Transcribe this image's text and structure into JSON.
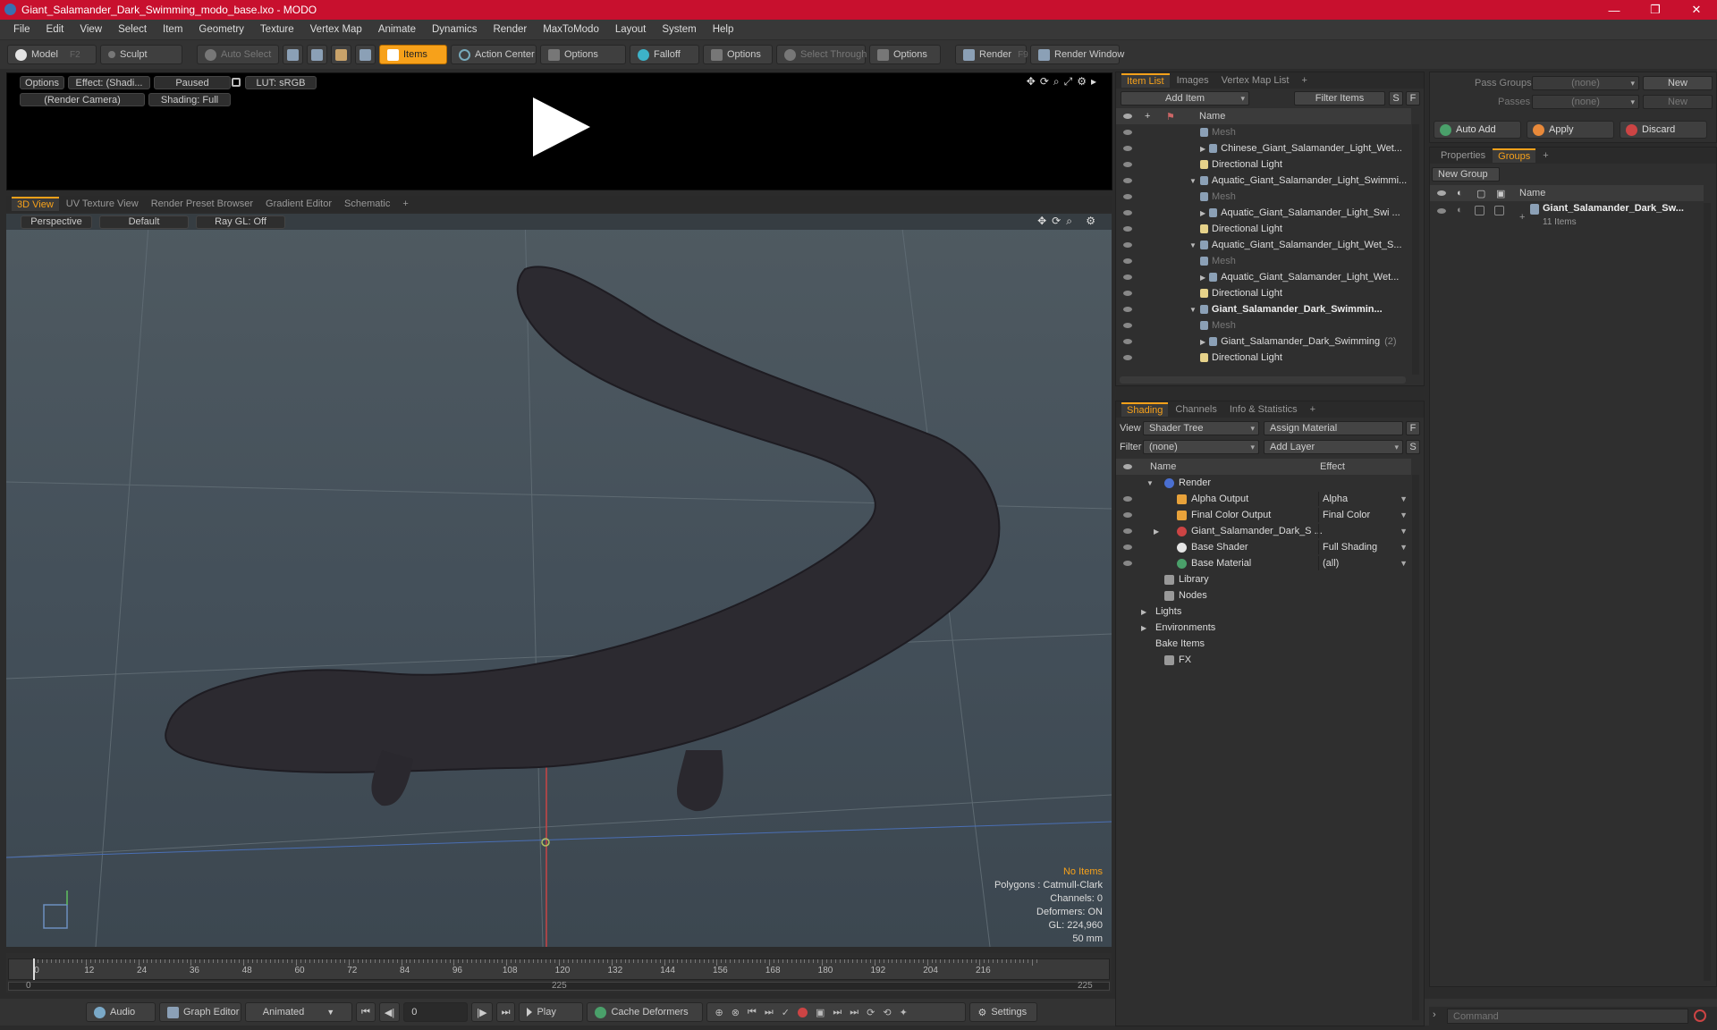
{
  "window": {
    "title": "Giant_Salamander_Dark_Swimming_modo_base.lxo - MODO",
    "controls": [
      "—",
      "❐",
      "✕"
    ]
  },
  "menu": [
    "File",
    "Edit",
    "View",
    "Select",
    "Item",
    "Geometry",
    "Texture",
    "Vertex Map",
    "Animate",
    "Dynamics",
    "Render",
    "MaxToModo",
    "Layout",
    "System",
    "Help"
  ],
  "toolbar": {
    "model": "Model",
    "model_key": "F2",
    "sculpt": "Sculpt",
    "auto_select": "Auto Select",
    "items": "Items",
    "action_center": "Action Center",
    "options1": "Options",
    "falloff": "Falloff",
    "options2": "Options",
    "select_through": "Select Through",
    "options3": "Options",
    "render": "Render",
    "render_key": "F9",
    "render_window": "Render Window"
  },
  "preview": {
    "options": "Options",
    "effect": "Effect: (Shadi...",
    "paused": "Paused",
    "lut": "LUT: sRGB",
    "camera": "(Render Camera)",
    "shading": "Shading: Full"
  },
  "view_tabs": [
    "3D View",
    "UV Texture View",
    "Render Preset Browser",
    "Gradient Editor",
    "Schematic",
    "+"
  ],
  "viewport": {
    "perspective": "Perspective",
    "default": "Default",
    "raygl": "Ray GL: Off",
    "stats": {
      "no_items": "No Items",
      "polygons": "Polygons : Catmull-Clark",
      "channels": "Channels: 0",
      "deformers": "Deformers: ON",
      "gl": "GL: 224,960",
      "mm": "50 mm"
    }
  },
  "timeline": {
    "ticks": [
      "0",
      "12",
      "24",
      "36",
      "48",
      "60",
      "72",
      "84",
      "96",
      "108",
      "120",
      "132",
      "144",
      "156",
      "168",
      "180",
      "192",
      "204",
      "216"
    ],
    "range_start": "0",
    "range_mid": "225",
    "range_end": "225"
  },
  "bottombar": {
    "audio": "Audio",
    "graph_editor": "Graph Editor",
    "animated": "Animated",
    "frame": "0",
    "play": "Play",
    "cache": "Cache Deformers",
    "settings": "Settings"
  },
  "itemlist": {
    "tabs": [
      "Item List",
      "Images",
      "Vertex Map List",
      "+"
    ],
    "add_item": "Add Item",
    "filter": "Filter Items",
    "s": "S",
    "f": "F",
    "name_header": "Name",
    "rows": [
      {
        "text": "Mesh",
        "indent": 2,
        "dim": true,
        "arrow": ""
      },
      {
        "text": "Chinese_Giant_Salamander_Light_Wet...",
        "indent": 2,
        "dim": false,
        "arrow": "▶"
      },
      {
        "text": "Directional Light",
        "indent": 2,
        "dim": false,
        "arrow": ""
      },
      {
        "text": "Aquatic_Giant_Salamander_Light_Swimmi...",
        "indent": 1,
        "dim": false,
        "arrow": "▼"
      },
      {
        "text": "Mesh",
        "indent": 2,
        "dim": true,
        "arrow": ""
      },
      {
        "text": "Aquatic_Giant_Salamander_Light_Swi ...",
        "indent": 2,
        "dim": false,
        "arrow": "▶"
      },
      {
        "text": "Directional Light",
        "indent": 2,
        "dim": false,
        "arrow": ""
      },
      {
        "text": "Aquatic_Giant_Salamander_Light_Wet_S...",
        "indent": 1,
        "dim": false,
        "arrow": "▼"
      },
      {
        "text": "Mesh",
        "indent": 2,
        "dim": true,
        "arrow": ""
      },
      {
        "text": "Aquatic_Giant_Salamander_Light_Wet...",
        "indent": 2,
        "dim": false,
        "arrow": "▶"
      },
      {
        "text": "Directional Light",
        "indent": 2,
        "dim": false,
        "arrow": ""
      },
      {
        "text": "Giant_Salamander_Dark_Swimmin...",
        "indent": 1,
        "dim": false,
        "arrow": "▼",
        "bold": true
      },
      {
        "text": "Mesh",
        "indent": 2,
        "dim": true,
        "arrow": ""
      },
      {
        "text": "Giant_Salamander_Dark_Swimming",
        "suffix": "(2)",
        "indent": 2,
        "dim": false,
        "arrow": "▶"
      },
      {
        "text": "Directional Light",
        "indent": 2,
        "dim": false,
        "arrow": ""
      }
    ]
  },
  "shading": {
    "tabs": [
      "Shading",
      "Channels",
      "Info & Statistics",
      "+"
    ],
    "view_label": "View",
    "view_value": "Shader Tree",
    "assign_material": "Assign Material",
    "filter_label": "Filter",
    "filter_value": "(none)",
    "add_layer": "Add Layer",
    "f": "F",
    "s": "S",
    "name_header": "Name",
    "effect_header": "Effect",
    "rows": [
      {
        "name": "Render",
        "effect": "",
        "indent": 0,
        "arrow": "▼",
        "eye": false
      },
      {
        "name": "Alpha Output",
        "effect": "Alpha",
        "indent": 1,
        "arrow": "",
        "eye": true
      },
      {
        "name": "Final Color Output",
        "effect": "Final Color",
        "indent": 1,
        "arrow": "",
        "eye": true
      },
      {
        "name": "Giant_Salamander_Dark_S ...",
        "effect": "",
        "indent": 1,
        "arrow": "▶",
        "eye": true
      },
      {
        "name": "Base Shader",
        "effect": "Full Shading",
        "indent": 1,
        "arrow": "",
        "eye": true
      },
      {
        "name": "Base Material",
        "effect": "(all)",
        "indent": 1,
        "arrow": "",
        "eye": true
      },
      {
        "name": "Library",
        "effect": "",
        "indent": 0,
        "arrow": "",
        "eye": false
      },
      {
        "name": "Nodes",
        "effect": "",
        "indent": 0,
        "arrow": "",
        "eye": false
      },
      {
        "name": "Lights",
        "effect": "",
        "indent": -1,
        "arrow": "▶",
        "eye": false
      },
      {
        "name": "Environments",
        "effect": "",
        "indent": -1,
        "arrow": "▶",
        "eye": false
      },
      {
        "name": "Bake Items",
        "effect": "",
        "indent": -1,
        "arrow": "",
        "eye": false
      },
      {
        "name": "FX",
        "effect": "",
        "indent": 0,
        "arrow": "",
        "eye": false
      }
    ]
  },
  "passes": {
    "pass_groups": "Pass Groups",
    "pass_value": "(none)",
    "new1": "New",
    "passes": "Passes",
    "passes_value": "(none)",
    "new2": "New",
    "auto_add": "Auto Add",
    "apply": "Apply",
    "discard": "Discard"
  },
  "groups": {
    "tabs": [
      "Properties",
      "Groups",
      "+"
    ],
    "new_group": "New Group",
    "name_header": "Name",
    "group_name": "Giant_Salamander_Dark_Sw...",
    "group_count": "11 Items"
  },
  "command": {
    "placeholder": "Command"
  },
  "colors": {
    "accent": "#f7a11a",
    "title_bar": "#c8102e"
  }
}
